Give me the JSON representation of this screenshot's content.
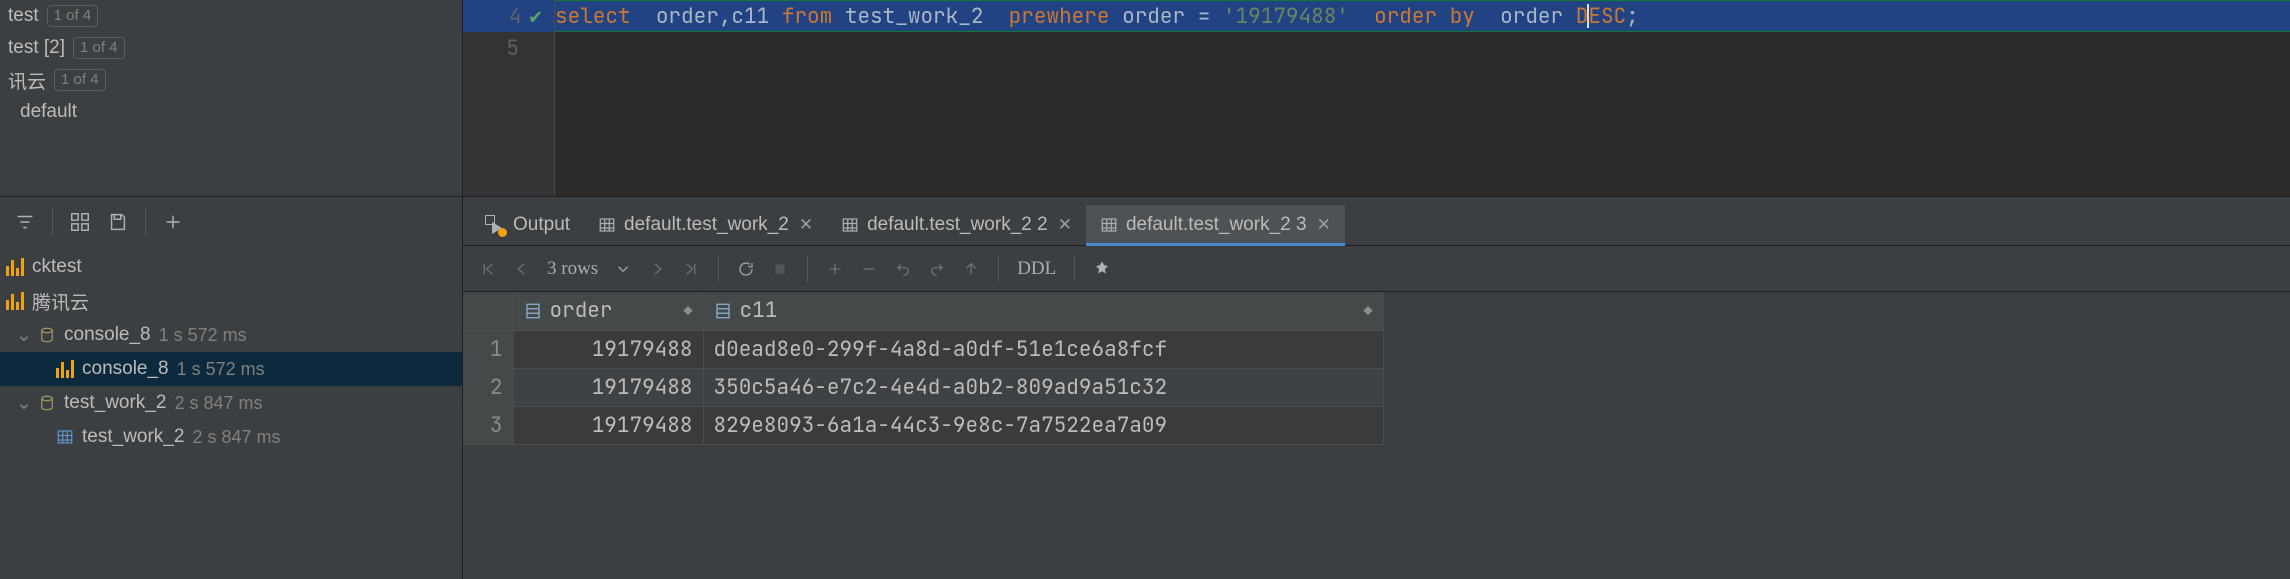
{
  "dbtree": {
    "items": [
      {
        "label": "test",
        "badge": "1 of 4"
      },
      {
        "label": "test [2]",
        "badge": "1 of 4"
      },
      {
        "label": "讯云",
        "badge": "1 of 4"
      },
      {
        "label": "default",
        "badge": ""
      }
    ]
  },
  "editor": {
    "line_no_4": "4",
    "line_no_5": "5",
    "kw_select": "select",
    "sp1": "  ",
    "id_order": "order",
    "comma": ",",
    "id_c11": "c11",
    "sp": " ",
    "kw_from": "from",
    "id_tbl": "test_work_2",
    "sp2": "  ",
    "kw_prewhere": "prewhere",
    "op_eq": " = ",
    "lit": "'19179488'",
    "sp3": "  ",
    "kw_orderby": "order by",
    "kw_desc": "DESC",
    "semi": ";"
  },
  "tabs": [
    {
      "label": "Output",
      "kind": "output",
      "closable": false,
      "active": false
    },
    {
      "label": "default.test_work_2",
      "kind": "table",
      "closable": true,
      "active": false
    },
    {
      "label": "default.test_work_2 2",
      "kind": "table",
      "closable": true,
      "active": false
    },
    {
      "label": "default.test_work_2 3",
      "kind": "table",
      "closable": true,
      "active": true
    }
  ],
  "svctree": [
    {
      "level": 0,
      "icon": "ybar",
      "label": "cktest",
      "ms": ""
    },
    {
      "level": 0,
      "icon": "ybar",
      "label": "腾讯云",
      "ms": ""
    },
    {
      "level": 1,
      "icon": "cyl",
      "label": "console_8",
      "ms": "1 s 572 ms",
      "expanded": true
    },
    {
      "level": 2,
      "icon": "ybar",
      "label": "console_8",
      "ms": "1 s 572 ms",
      "selected": true
    },
    {
      "level": 1,
      "icon": "cyl",
      "label": "test_work_2",
      "ms": "2 s 847 ms",
      "expanded": true
    },
    {
      "level": 2,
      "icon": "grid",
      "label": "test_work_2",
      "ms": "2 s 847 ms"
    }
  ],
  "results": {
    "rowcount_label": "3 rows",
    "ddl_label": "DDL",
    "columns": [
      "order",
      "c11"
    ],
    "rows": [
      {
        "n": "1",
        "order": "19179488",
        "c11": "d0ead8e0-299f-4a8d-a0df-51e1ce6a8fcf"
      },
      {
        "n": "2",
        "order": "19179488",
        "c11": "350c5a46-e7c2-4e4d-a0b2-809ad9a51c32"
      },
      {
        "n": "3",
        "order": "19179488",
        "c11": "829e8093-6a1a-44c3-9e8c-7a7522ea7a09"
      }
    ]
  },
  "chart_data": {
    "type": "table",
    "columns": [
      "order",
      "c11"
    ],
    "rows": [
      [
        "19179488",
        "d0ead8e0-299f-4a8d-a0df-51e1ce6a8fcf"
      ],
      [
        "19179488",
        "350c5a46-e7c2-4e4d-a0b2-809ad9a51c32"
      ],
      [
        "19179488",
        "829e8093-6a1a-44c3-9e8c-7a7522ea7a09"
      ]
    ]
  }
}
